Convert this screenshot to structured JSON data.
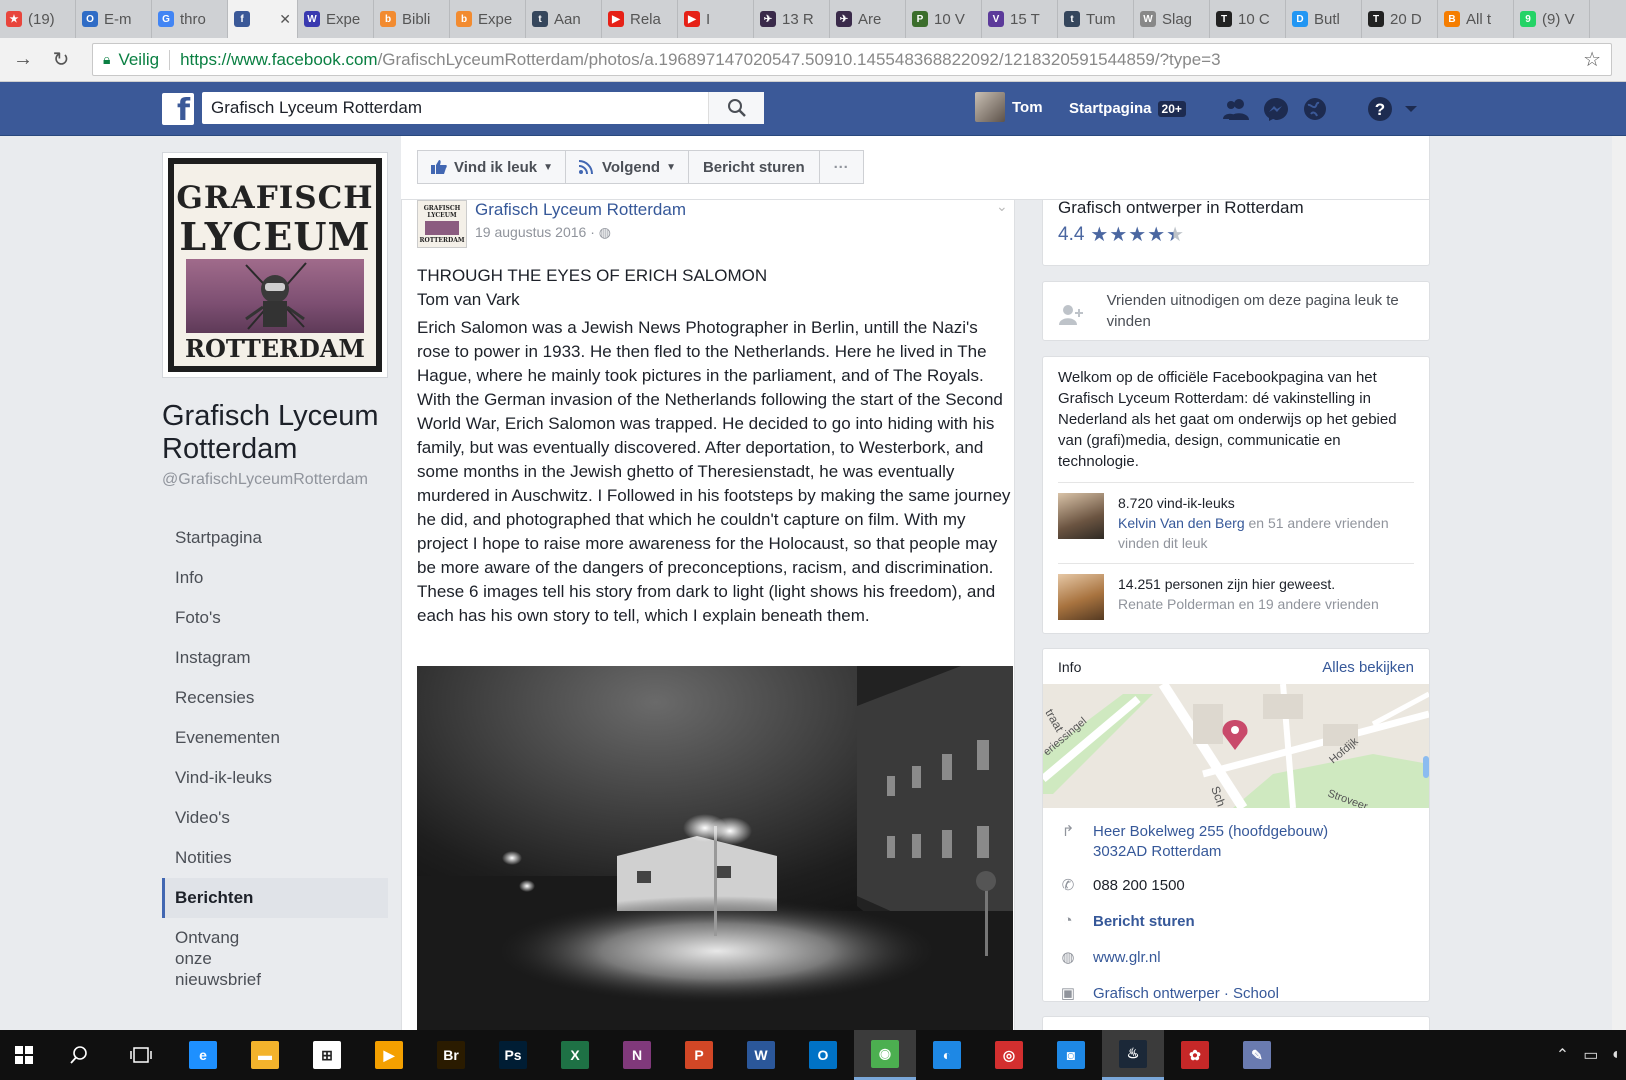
{
  "browser": {
    "tabs": [
      {
        "label": "(19)",
        "color": "#e8453c",
        "glyph": "★"
      },
      {
        "label": "E-m",
        "color": "#2f6cc6",
        "glyph": "O"
      },
      {
        "label": "thro",
        "color": "#4285f4",
        "glyph": "G"
      },
      {
        "label": "",
        "color": "#3b5998",
        "glyph": "f",
        "active": true
      },
      {
        "label": "Expe",
        "color": "#3a3ab0",
        "glyph": "W"
      },
      {
        "label": "Bibli",
        "color": "#f28b30",
        "glyph": "b"
      },
      {
        "label": "Expe",
        "color": "#f28b30",
        "glyph": "b"
      },
      {
        "label": "Aan",
        "color": "#35465c",
        "glyph": "t"
      },
      {
        "label": "Rela",
        "color": "#e62117",
        "glyph": "▶"
      },
      {
        "label": "I",
        "color": "#e62117",
        "glyph": "▶"
      },
      {
        "label": "13 R",
        "color": "#3a2a4a",
        "glyph": "✈"
      },
      {
        "label": "Are",
        "color": "#3a2a4a",
        "glyph": "✈"
      },
      {
        "label": "10 V",
        "color": "#3c6e2c",
        "glyph": "P"
      },
      {
        "label": "15 T",
        "color": "#5c3a9a",
        "glyph": "V"
      },
      {
        "label": "Tum",
        "color": "#35465c",
        "glyph": "t"
      },
      {
        "label": "Slag",
        "color": "#888888",
        "glyph": "W"
      },
      {
        "label": "10 C",
        "color": "#222222",
        "glyph": "T"
      },
      {
        "label": "Butl",
        "color": "#2196f3",
        "glyph": "D"
      },
      {
        "label": "20 D",
        "color": "#222222",
        "glyph": "T"
      },
      {
        "label": "All t",
        "color": "#f57d00",
        "glyph": "B"
      },
      {
        "label": "(9) V",
        "color": "#25d366",
        "glyph": "9"
      }
    ],
    "secure_label": "Veilig",
    "url_host": "https://www.facebook.com",
    "url_path": "/GrafischLyceumRotterdam/photos/a.196897147020547.50910.145548368822092/1218320591544859/?type=3"
  },
  "fb": {
    "search_value": "Grafisch Lyceum Rotterdam",
    "user_name": "Tom",
    "home_label": "Startpagina",
    "home_badge": "20+"
  },
  "page": {
    "logo": {
      "line1": "GRAFISCH",
      "line2": "LYCEUM",
      "line3": "ROTTERDAM"
    },
    "name": "Grafisch Lyceum Rotterdam",
    "handle": "@GrafischLyceumRotterdam",
    "nav": [
      {
        "label": "Startpagina",
        "name": "nav-startpagina"
      },
      {
        "label": "Info",
        "name": "nav-info"
      },
      {
        "label": "Foto's",
        "name": "nav-fotos"
      },
      {
        "label": "Instagram",
        "name": "nav-instagram"
      },
      {
        "label": "Recensies",
        "name": "nav-recensies"
      },
      {
        "label": "Evenementen",
        "name": "nav-evenementen"
      },
      {
        "label": "Vind-ik-leuks",
        "name": "nav-vind-ik-leuks"
      },
      {
        "label": "Video's",
        "name": "nav-videos"
      },
      {
        "label": "Notities",
        "name": "nav-notities"
      },
      {
        "label": "Berichten",
        "name": "nav-berichten",
        "active": true
      },
      {
        "label": "Ontvang onze nieuwsbrief",
        "name": "nav-nieuwsbrief"
      }
    ]
  },
  "actions": {
    "like": "Vind ik leuk",
    "follow": "Volgend",
    "message": "Bericht sturen",
    "more": "···"
  },
  "post": {
    "avatar_text": [
      "GRAFISCH",
      "LYCEUM",
      "ROTTERDAM"
    ],
    "author": "Grafisch Lyceum Rotterdam",
    "date": "19 augustus 2016 ·",
    "title": "THROUGH THE EYES OF ERICH SALOMON",
    "subtitle": "Tom van Vark",
    "body": "Erich Salomon was a Jewish News Photographer in Berlin, untill the Nazi's rose to power in 1933. He then fled to the Netherlands. Here he lived in The Hague, where he mainly took pictures in the parliament, and of The Royals. With the German invasion of the Netherlands following the start of the Second World War, Erich Salomon was trapped. He decided to go into hiding with his family, but was eventually discovered. After deportation, to Westerbork, and some months in the Jewish ghetto of Theresienstadt, he was eventually murdered in Auschwitz. I Followed in his footsteps by making the same journey he did, and photographed that which he couldn't capture on film. With my project I hope to raise more awareness for the Holocaust, so that people may be more aware of the dangers of preconceptions, racism, and discrimination. These 6 images tell his story from dark to light (light shows his freedom), and each has his own story to tell, which I explain beneath them."
  },
  "sidebar": {
    "category": "Grafisch ontwerper in Rotterdam",
    "rating": "4.4",
    "rating_value": 4.4,
    "rating_max": 5,
    "invite_text": "Vrienden uitnodigen om deze pagina leuk te vinden",
    "about_text": "Welkom op de officiële Facebookpagina van het Grafisch Lyceum Rotterdam: dé vakinstelling in Nederland als het gaat om onderwijs op het gebied van (grafi)media, design, communicatie en technologie.",
    "likes_count": "8.720 vind-ik-leuks",
    "likes_friend": "Kelvin Van den Berg",
    "likes_rest": " en 51 andere vrienden vinden dit leuk",
    "visits_count": "14.251 personen zijn hier geweest.",
    "visits_friends": "Renate Polderman en 19 andere vrienden",
    "info_heading": "Info",
    "see_all": "Alles bekijken",
    "map_labels": [
      "traat",
      "eriessingel",
      "Sch",
      "Hofdijk",
      "Stroveer"
    ],
    "address_line1": "Heer Bokelweg 255 (hoofdgebouw)",
    "address_line2": "3032AD Rotterdam",
    "phone": "088 200 1500",
    "message": "Bericht sturen",
    "website": "www.glr.nl",
    "categories": "Grafisch ontwerper · School"
  },
  "taskbar": {
    "apps": [
      {
        "name": "edge",
        "label": "e",
        "color": "#1e90ff"
      },
      {
        "name": "explorer",
        "label": "▬",
        "color": "#f3b32c"
      },
      {
        "name": "store",
        "label": "⊞",
        "color": "#ffffff"
      },
      {
        "name": "media",
        "label": "▶",
        "color": "#f4a000"
      },
      {
        "name": "bridge",
        "label": "Br",
        "color": "#2a1b00"
      },
      {
        "name": "photoshop",
        "label": "Ps",
        "color": "#001d34"
      },
      {
        "name": "excel",
        "label": "X",
        "color": "#1e7145"
      },
      {
        "name": "onenote",
        "label": "N",
        "color": "#80397b"
      },
      {
        "name": "powerpoint",
        "label": "P",
        "color": "#d24726"
      },
      {
        "name": "word",
        "label": "W",
        "color": "#2b579a"
      },
      {
        "name": "outlook",
        "label": "O",
        "color": "#0072c6"
      },
      {
        "name": "chrome",
        "label": "◉",
        "color": "#4caf50",
        "active": true
      },
      {
        "name": "app-blue",
        "label": "◐",
        "color": "#1e88e5"
      },
      {
        "name": "app-red",
        "label": "◎",
        "color": "#d32f2f"
      },
      {
        "name": "app-camera",
        "label": "◙",
        "color": "#1e88e5"
      },
      {
        "name": "steam",
        "label": "♨",
        "color": "#1b2838",
        "active": true
      },
      {
        "name": "app-dots",
        "label": "✿",
        "color": "#c62828"
      },
      {
        "name": "paint",
        "label": "✎",
        "color": "#6a7bb0"
      }
    ]
  },
  "colors": {
    "fb_blue": "#3b5998",
    "link": "#365899"
  }
}
